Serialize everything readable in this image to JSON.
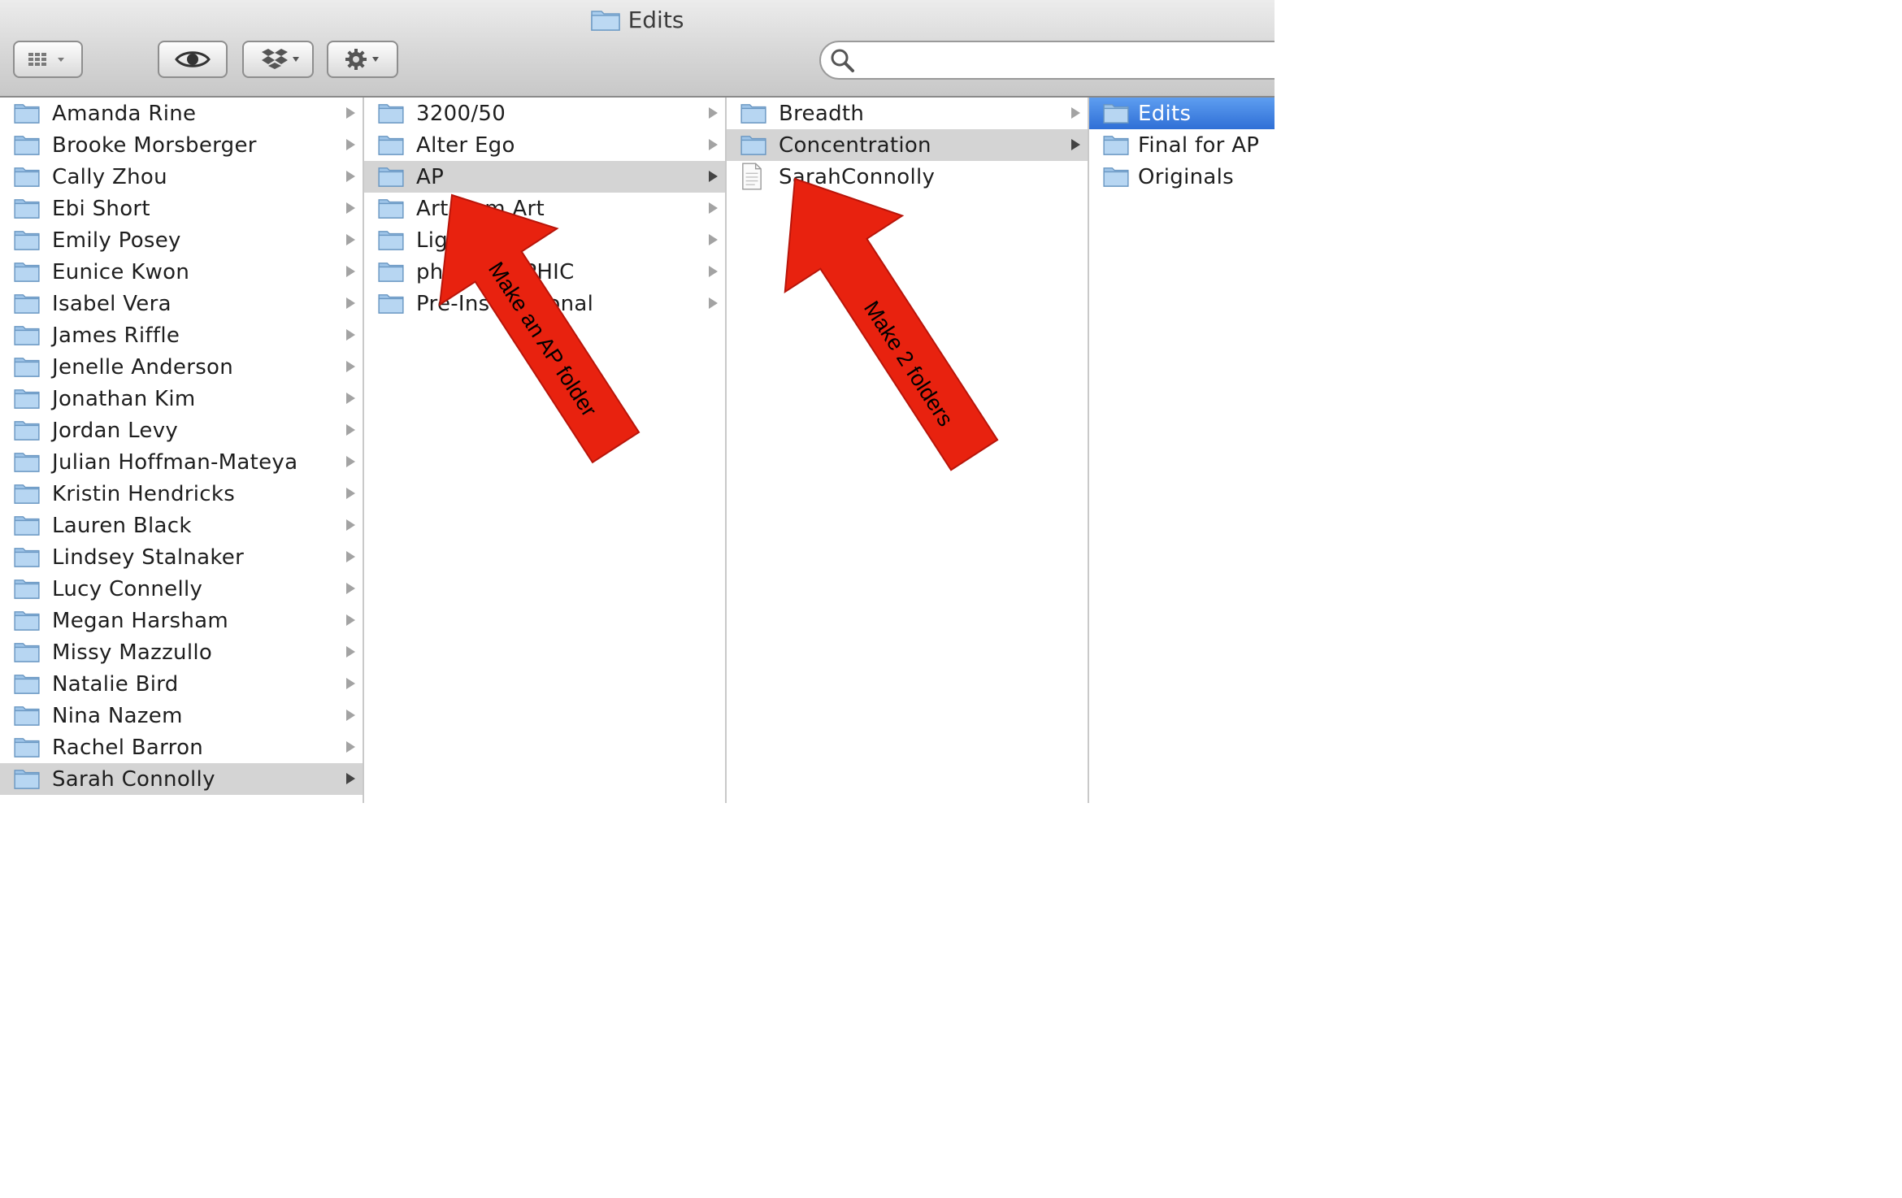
{
  "window": {
    "title": "Edits"
  },
  "toolbar": {
    "view_icon": "column-view-icon",
    "quicklook_icon": "eye-icon",
    "dropbox_icon": "dropbox-icon",
    "action_icon": "gear-icon",
    "search_icon": "magnifier-icon",
    "search_value": ""
  },
  "columns": [
    {
      "items": [
        {
          "label": "Amanda Rine"
        },
        {
          "label": "Brooke Morsberger"
        },
        {
          "label": "Cally Zhou"
        },
        {
          "label": "Ebi Short"
        },
        {
          "label": "Emily Posey"
        },
        {
          "label": "Eunice Kwon"
        },
        {
          "label": "Isabel Vera"
        },
        {
          "label": "James Riffle"
        },
        {
          "label": "Jenelle Anderson"
        },
        {
          "label": "Jonathan Kim"
        },
        {
          "label": "Jordan Levy"
        },
        {
          "label": "Julian Hoffman-Mateya"
        },
        {
          "label": "Kristin Hendricks"
        },
        {
          "label": "Lauren Black"
        },
        {
          "label": "Lindsey Stalnaker"
        },
        {
          "label": "Lucy Connelly"
        },
        {
          "label": "Megan Harsham"
        },
        {
          "label": "Missy Mazzullo"
        },
        {
          "label": "Natalie Bird"
        },
        {
          "label": "Nina Nazem"
        },
        {
          "label": "Rachel Barron"
        },
        {
          "label": "Sarah Connolly"
        }
      ],
      "selected_index": 21
    },
    {
      "items": [
        {
          "label": "3200/50"
        },
        {
          "label": "Alter Ego"
        },
        {
          "label": "AP"
        },
        {
          "label": "Art from Art"
        },
        {
          "label": "Light"
        },
        {
          "label": "photoGRAPHIC"
        },
        {
          "label": "Pre-Instructional"
        }
      ],
      "selected_index": 2
    },
    {
      "items": [
        {
          "label": "Breadth",
          "kind": "folder"
        },
        {
          "label": "Concentration",
          "kind": "folder"
        },
        {
          "label": "SarahConnolly",
          "kind": "document"
        }
      ],
      "selected_index": 1
    },
    {
      "items": [
        {
          "label": "Edits"
        },
        {
          "label": "Final for AP"
        },
        {
          "label": "Originals"
        }
      ],
      "selected_index": 0
    }
  ],
  "annotations": [
    {
      "text": "Make an AP folder",
      "color": "#e8220f"
    },
    {
      "text": "Make 2 folders",
      "color": "#e8220f"
    }
  ],
  "colors": {
    "selection_blue": "#3a7de0",
    "selection_grey": "#d4d4d4",
    "folder_blue": "#9cc6ec",
    "arrow_red": "#e8220f"
  }
}
